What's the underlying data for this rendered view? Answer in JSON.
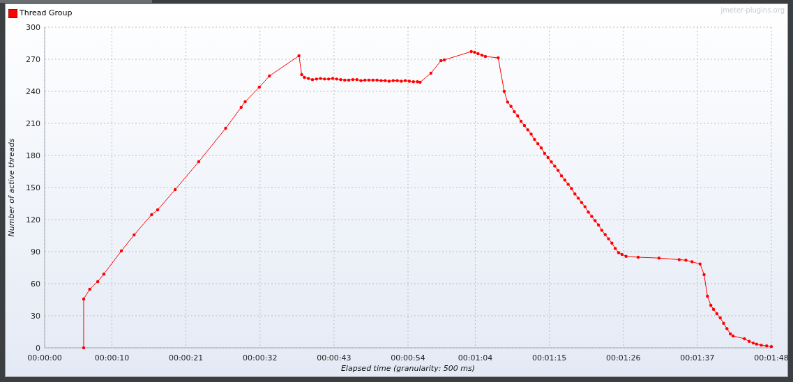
{
  "watermark": "jmeter-plugins.org",
  "chart_data": {
    "type": "line",
    "xlabel": "Elapsed time (granularity: 500 ms)",
    "ylabel": "Number of active threads",
    "x": [
      5.8,
      5.8,
      6.7,
      7.9,
      8.8,
      11.4,
      13.3,
      15.9,
      16.8,
      19.4,
      22.9,
      26.9,
      29.2,
      29.8,
      31.9,
      33.4,
      37.8,
      38.2,
      38.6,
      39.2,
      39.8,
      40.4,
      41.0,
      41.6,
      42.2,
      42.8,
      43.4,
      44.0,
      44.6,
      45.2,
      45.8,
      46.4,
      47.0,
      47.6,
      48.2,
      48.8,
      49.4,
      50.0,
      50.6,
      51.2,
      51.8,
      52.4,
      53.0,
      53.6,
      54.2,
      54.8,
      55.4,
      55.8,
      57.4,
      58.9,
      59.4,
      63.4,
      63.9,
      64.4,
      65.0,
      65.5,
      67.4,
      68.3,
      68.8,
      69.3,
      69.8,
      70.3,
      70.8,
      71.3,
      71.8,
      72.3,
      72.8,
      73.3,
      73.8,
      74.3,
      74.8,
      75.3,
      75.8,
      76.3,
      76.8,
      77.3,
      77.8,
      78.3,
      78.8,
      79.3,
      79.8,
      80.3,
      80.8,
      81.3,
      81.8,
      82.3,
      82.8,
      83.3,
      83.8,
      84.3,
      84.8,
      85.3,
      85.8,
      86.4,
      88.2,
      91.3,
      94.3,
      95.3,
      96.2,
      97.4,
      98.0,
      98.5,
      99.0,
      99.4,
      99.9,
      100.4,
      100.9,
      101.4,
      101.9,
      102.3,
      104.0,
      104.7,
      105.3,
      105.8,
      106.5,
      107.3,
      108.0
    ],
    "series": [
      {
        "name": "Thread Group",
        "color": "#ff0000",
        "values": [
          0,
          45.7,
          54.8,
          62,
          69,
          90.7,
          105.7,
          124.6,
          129.1,
          148,
          174.1,
          205.4,
          225,
          230.2,
          243.9,
          254.3,
          273.3,
          255.7,
          253,
          252,
          251,
          251.5,
          252,
          251.5,
          251.5,
          252,
          251.5,
          251,
          250.5,
          250.5,
          251,
          251,
          250,
          250.5,
          250.5,
          250.5,
          250.5,
          250,
          250,
          249.5,
          250,
          250,
          249.5,
          250,
          249.5,
          249,
          249,
          248.5,
          257,
          268.7,
          269.4,
          277.2,
          276.5,
          275.2,
          273.8,
          272.6,
          271.3,
          240,
          230,
          226,
          221,
          217,
          212,
          208,
          204,
          200,
          195,
          191,
          187,
          182,
          178,
          174,
          170,
          166,
          161,
          157,
          153,
          149,
          144,
          140,
          136,
          132,
          127,
          123,
          119,
          115,
          110,
          106,
          102,
          98,
          93,
          89,
          87.4,
          85.6,
          84.8,
          84,
          82.5,
          82,
          80.5,
          78.5,
          68.5,
          48.3,
          39.8,
          36,
          32,
          28,
          23,
          18,
          13,
          11.1,
          8.5,
          6,
          4.5,
          3.5,
          2.5,
          1.8,
          1.2
        ]
      }
    ],
    "grid": true,
    "xlim": [
      0,
      108
    ],
    "ylim": [
      0,
      300
    ],
    "xticks": [
      {
        "value": 0,
        "label": "00:00:00"
      },
      {
        "value": 10,
        "label": "00:00:10"
      },
      {
        "value": 21,
        "label": "00:00:21"
      },
      {
        "value": 32,
        "label": "00:00:32"
      },
      {
        "value": 43,
        "label": "00:00:43"
      },
      {
        "value": 54,
        "label": "00:00:54"
      },
      {
        "value": 64,
        "label": "00:01:04"
      },
      {
        "value": 75,
        "label": "00:01:15"
      },
      {
        "value": 86,
        "label": "00:01:26"
      },
      {
        "value": 97,
        "label": "00:01:37"
      },
      {
        "value": 108,
        "label": "00:01:48"
      }
    ],
    "yticks": [
      0,
      30,
      60,
      90,
      120,
      150,
      180,
      210,
      240,
      270,
      300
    ]
  }
}
